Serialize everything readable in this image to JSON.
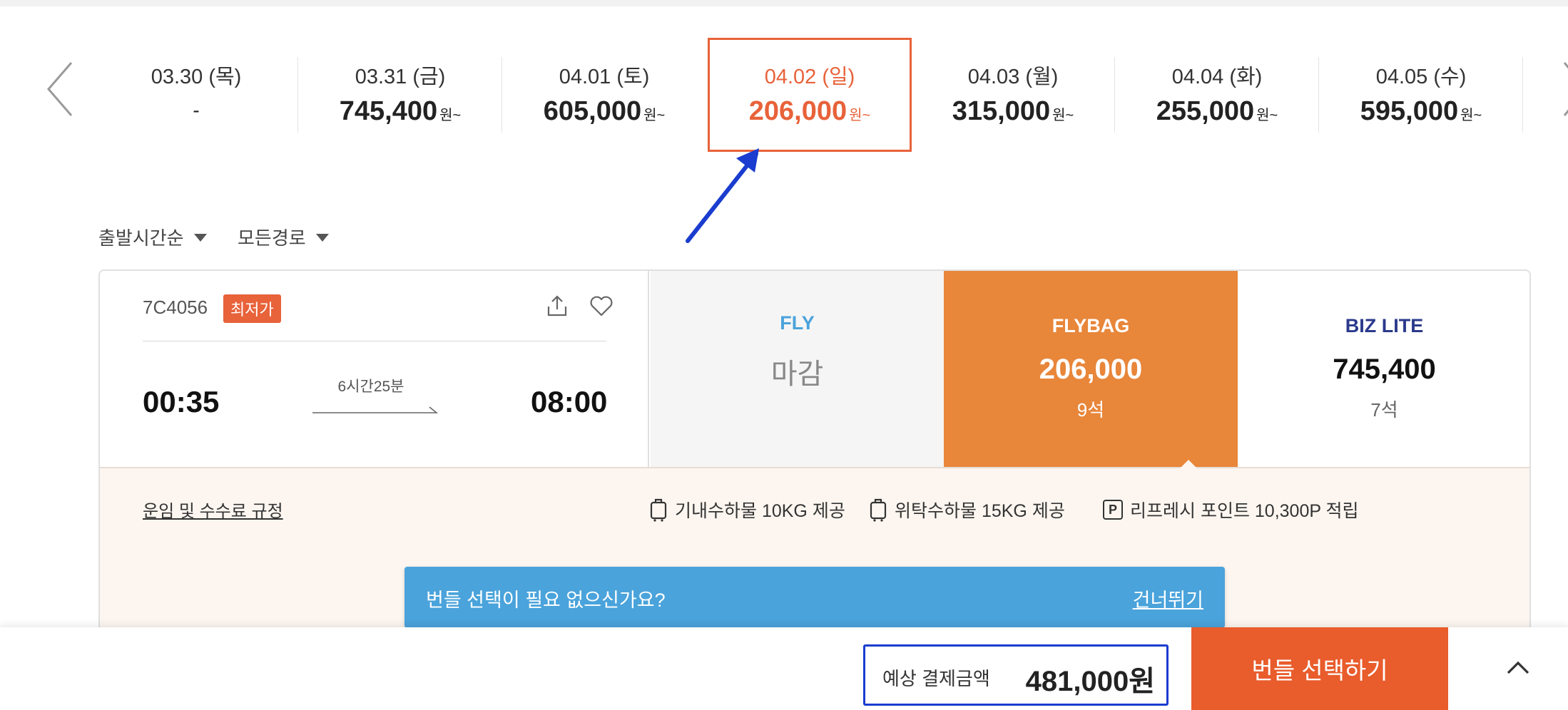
{
  "dates": [
    {
      "date": "03.30 (목)",
      "price": "-",
      "unit": ""
    },
    {
      "date": "03.31 (금)",
      "price": "745,400",
      "unit": "원~"
    },
    {
      "date": "04.01 (토)",
      "price": "605,000",
      "unit": "원~"
    },
    {
      "date": "04.02 (일)",
      "price": "206,000",
      "unit": "원~"
    },
    {
      "date": "04.03 (월)",
      "price": "315,000",
      "unit": "원~"
    },
    {
      "date": "04.04 (화)",
      "price": "255,000",
      "unit": "원~"
    },
    {
      "date": "04.05 (수)",
      "price": "595,000",
      "unit": "원~"
    }
  ],
  "filters": {
    "sort": "출발시간순",
    "route": "모든경로"
  },
  "flight": {
    "number": "7C4056",
    "badge": "최저가",
    "departure": "00:35",
    "arrival": "08:00",
    "duration": "6시간25분"
  },
  "fares": {
    "fly": {
      "name": "FLY",
      "status": "마감"
    },
    "flybag": {
      "name": "FLYBAG",
      "price": "206,000",
      "seats": "9석"
    },
    "biz": {
      "name": "BIZ LITE",
      "price": "745,400",
      "seats": "7석"
    }
  },
  "details": {
    "rules_link": "운임 및 수수료 규정",
    "benefits": [
      "기내수하물 10KG 제공",
      "위탁수하물 15KG 제공",
      "리프레시 포인트 10,300P 적립"
    ],
    "point_icon_letter": "P"
  },
  "skip": {
    "text": "번들 선택이 필요 없으신가요?",
    "link": "건너뛰기"
  },
  "bottom": {
    "total_label": "예상 결제금액",
    "total_value": "481,000원",
    "select_button": "번들 선택하기"
  },
  "colors": {
    "accent": "#e8623a",
    "flybag": "#e8863a",
    "skip_banner": "#4aa3db",
    "annotation": "#1a3ccf"
  }
}
